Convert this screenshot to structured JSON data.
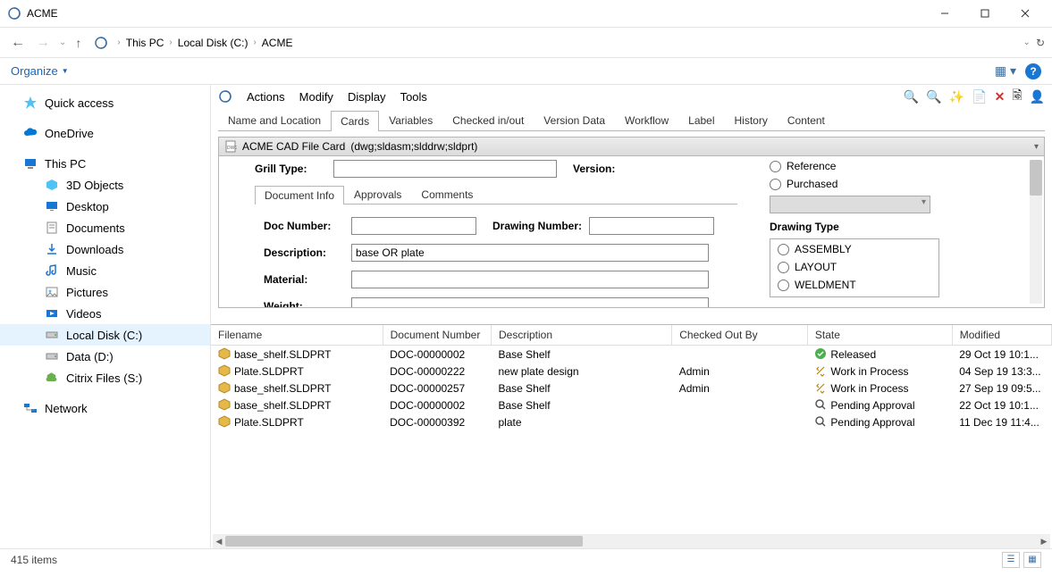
{
  "window": {
    "title": "ACME"
  },
  "breadcrumb": [
    "This PC",
    "Local Disk (C:)",
    "ACME"
  ],
  "toolbar": {
    "organize": "Organize"
  },
  "sidebar": {
    "quick_access": "Quick access",
    "onedrive": "OneDrive",
    "this_pc": "This PC",
    "children": [
      "3D Objects",
      "Desktop",
      "Documents",
      "Downloads",
      "Music",
      "Pictures",
      "Videos",
      "Local Disk (C:)",
      "Data (D:)",
      "Citrix Files (S:)"
    ],
    "network": "Network"
  },
  "pdm_menu": [
    "Actions",
    "Modify",
    "Display",
    "Tools"
  ],
  "pdm_tabs": [
    "Name and Location",
    "Cards",
    "Variables",
    "Checked in/out",
    "Version Data",
    "Workflow",
    "Label",
    "History",
    "Content"
  ],
  "pdm_active_tab": 1,
  "card_header": {
    "label": "ACME CAD File Card",
    "extensions": "(dwg;sldasm;slddrw;sldprt)"
  },
  "card": {
    "grill_type_label": "Grill Type:",
    "version_label": "Version:",
    "doc_tabs": [
      "Document Info",
      "Approvals",
      "Comments"
    ],
    "doc_tab_active": 0,
    "fields": {
      "doc_number_label": "Doc Number:",
      "doc_number": "",
      "drawing_number_label": "Drawing Number:",
      "drawing_number": "",
      "description_label": "Description:",
      "description": "base OR plate",
      "material_label": "Material:",
      "material": "",
      "weight_label": "Weight:",
      "weight": ""
    },
    "options": {
      "reference": "Reference",
      "purchased": "Purchased"
    },
    "drawing_type": {
      "heading": "Drawing Type",
      "items": [
        "ASSEMBLY",
        "LAYOUT",
        "WELDMENT"
      ]
    }
  },
  "filelist": {
    "columns": [
      "Filename",
      "Document Number",
      "Description",
      "Checked Out By",
      "State",
      "Modified"
    ],
    "rows": [
      {
        "filename": "base_shelf.SLDPRT",
        "docnum": "DOC-00000002",
        "desc": "Base Shelf",
        "checkedout": "",
        "state": "Released",
        "state_icon": "green",
        "modified": "29 Oct 19 10:1..."
      },
      {
        "filename": "Plate.SLDPRT",
        "docnum": "DOC-00000222",
        "desc": "new plate design",
        "checkedout": "Admin",
        "state": "Work in Process",
        "state_icon": "wip",
        "modified": "04 Sep 19 13:3..."
      },
      {
        "filename": "base_shelf.SLDPRT",
        "docnum": "DOC-00000257",
        "desc": "Base Shelf",
        "checkedout": "Admin",
        "state": "Work in Process",
        "state_icon": "wip",
        "modified": "27 Sep 19 09:5..."
      },
      {
        "filename": "base_shelf.SLDPRT",
        "docnum": "DOC-00000002",
        "desc": "Base Shelf",
        "checkedout": "",
        "state": "Pending Approval",
        "state_icon": "pending",
        "modified": "22 Oct 19 10:1..."
      },
      {
        "filename": "Plate.SLDPRT",
        "docnum": "DOC-00000392",
        "desc": "plate",
        "checkedout": "",
        "state": "Pending Approval",
        "state_icon": "pending",
        "modified": "11 Dec 19 11:4..."
      }
    ]
  },
  "statusbar": {
    "text": "415 items"
  }
}
